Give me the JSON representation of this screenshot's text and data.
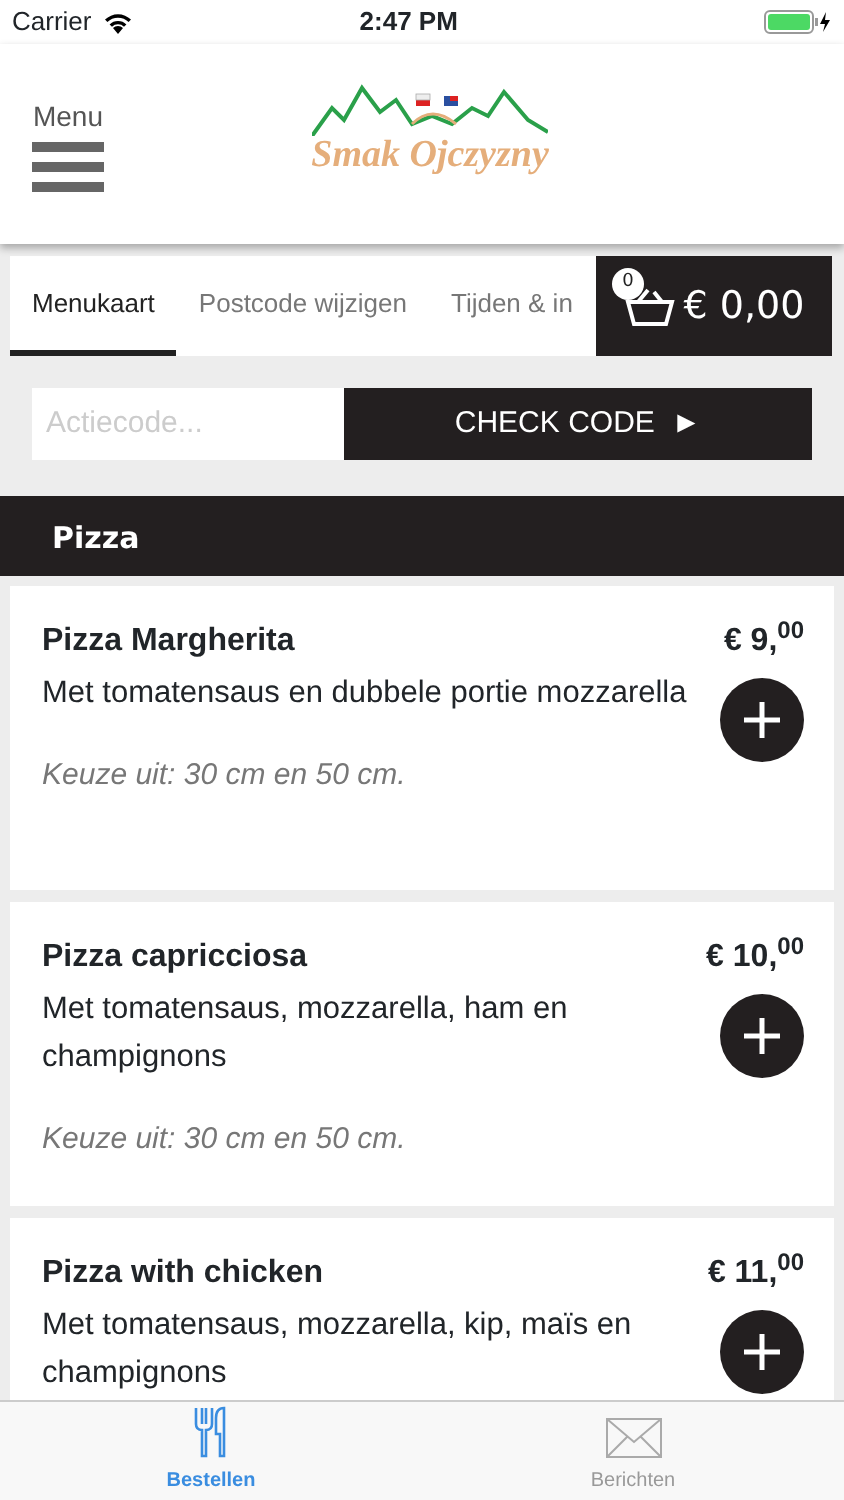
{
  "status_bar": {
    "carrier": "Carrier",
    "time": "2:47 PM"
  },
  "header": {
    "menu_label": "Menu",
    "logo_text": "Smak Ojczyzny"
  },
  "tabs": [
    {
      "label": "Menukaart",
      "selected": true
    },
    {
      "label": "Postcode wijzigen",
      "selected": false
    },
    {
      "label": "Tijden & in",
      "selected": false
    }
  ],
  "cart": {
    "count": "0",
    "total": "€ 0,00"
  },
  "promo": {
    "placeholder": "Actiecode...",
    "button": "CHECK CODE",
    "button_icon": "►"
  },
  "category": "Pizza",
  "items": [
    {
      "name": "Pizza Margherita",
      "description": "Met tomatensaus en dubbele portie mozzarella",
      "price": "€ 9,$^{00}$",
      "options": "Keuze uit: 30 cm en 50 cm."
    },
    {
      "name": "Pizza capricciosa",
      "description": "Met tomatensaus, mozzarella, ham en champignons",
      "price": "€ 10,$^{00}$",
      "options": "Keuze uit: 30 cm en 50 cm."
    },
    {
      "name": "Pizza with chicken",
      "description": "Met tomatensaus, mozzarella, kip, maïs en champignons",
      "price": "€ 11,$^{00}$"
    }
  ],
  "bottom_tabs": [
    {
      "label": "Bestellen",
      "kind": "order",
      "selected": true
    },
    {
      "label": "Berichten",
      "kind": "messages",
      "selected": false
    }
  ]
}
